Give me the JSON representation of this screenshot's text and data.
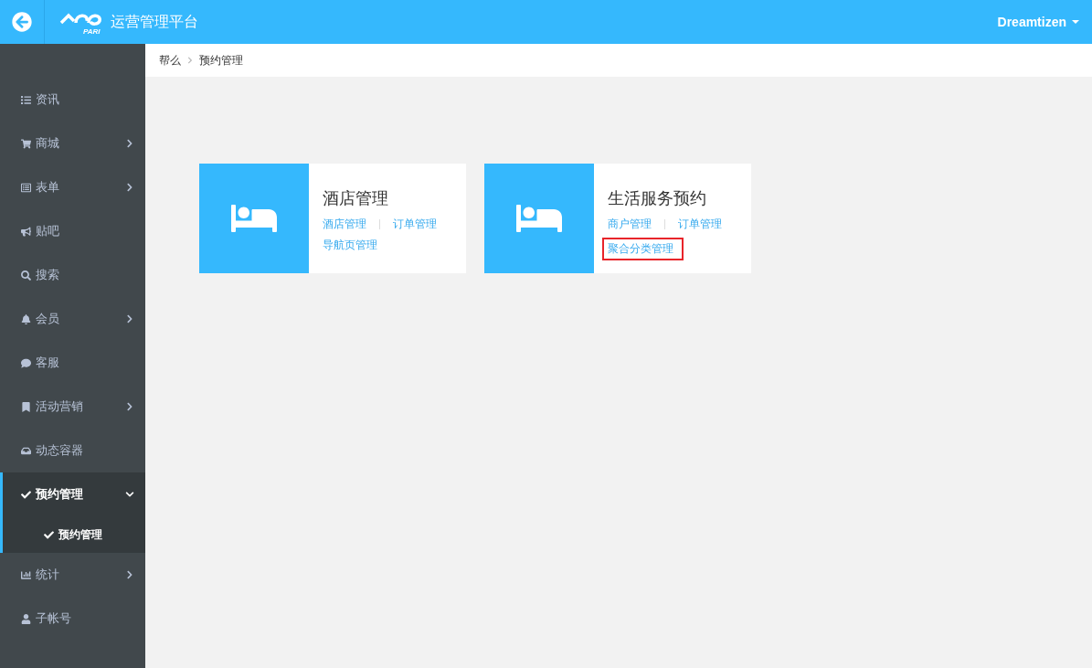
{
  "header": {
    "title": "运营管理平台",
    "logo_text": "PARI",
    "user": "Dreamtizen"
  },
  "sidebar": {
    "items": [
      {
        "label": "资讯",
        "selected": false
      },
      {
        "label": "商城",
        "selected": false,
        "expanded": false
      },
      {
        "label": "表单",
        "selected": false,
        "expanded": false
      },
      {
        "label": "贴吧",
        "selected": false
      },
      {
        "label": "搜索",
        "selected": false
      },
      {
        "label": "会员",
        "selected": false,
        "expanded": false
      },
      {
        "label": "客服",
        "selected": false
      },
      {
        "label": "活动营销",
        "selected": false,
        "expanded": false
      },
      {
        "label": "动态容器",
        "selected": false
      },
      {
        "label": "预约管理",
        "selected": true,
        "expanded": true,
        "children": [
          {
            "label": "预约管理",
            "selected": true
          }
        ]
      },
      {
        "label": "统计",
        "selected": false,
        "expanded": false
      },
      {
        "label": "子帐号",
        "selected": false
      }
    ]
  },
  "breadcrumb": [
    "帮么",
    "预约管理"
  ],
  "cards": [
    {
      "title": "酒店管理",
      "links": [
        {
          "label": "酒店管理",
          "highlighted": false
        },
        {
          "label": "订单管理",
          "highlighted": false
        },
        {
          "label": "导航页管理",
          "highlighted": false
        }
      ]
    },
    {
      "title": "生活服务预约",
      "links": [
        {
          "label": "商户管理",
          "highlighted": false
        },
        {
          "label": "订单管理",
          "highlighted": false
        },
        {
          "label": "聚合分类管理",
          "highlighted": true
        }
      ]
    }
  ]
}
